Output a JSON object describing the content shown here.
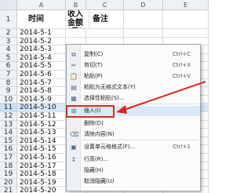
{
  "sheet": {
    "columns": [
      "A",
      "B",
      "C",
      "D",
      "E"
    ],
    "header": {
      "rownum": "1",
      "a": "时间",
      "b": "收入金额(元)",
      "c": "备注"
    },
    "rows": [
      {
        "num": "2",
        "date": "2014-5-1"
      },
      {
        "num": "3",
        "date": "2014-5-2"
      },
      {
        "num": "4",
        "date": "2014-5-3"
      },
      {
        "num": "5",
        "date": "2014-5-4"
      },
      {
        "num": "6",
        "date": "2014-5-5"
      },
      {
        "num": "7",
        "date": "2014-5-6"
      },
      {
        "num": "8",
        "date": "2014-5-7"
      },
      {
        "num": "9",
        "date": "2014-5-8"
      },
      {
        "num": "10",
        "date": "2014-5-9"
      },
      {
        "num": "11",
        "date": "2014-5-10"
      },
      {
        "num": "12",
        "date": "2014-5-11"
      },
      {
        "num": "13",
        "date": "2014-5-12"
      },
      {
        "num": "14",
        "date": "2014-5-13"
      },
      {
        "num": "15",
        "date": "2014-5-14"
      },
      {
        "num": "16",
        "date": "2014-5-15"
      },
      {
        "num": "17",
        "date": "2014-5-16"
      },
      {
        "num": "18",
        "date": "2014-5-17"
      },
      {
        "num": "19",
        "date": "2014-5-18"
      },
      {
        "num": "20",
        "date": "2014-5-19"
      },
      {
        "num": "21",
        "date": "2014-5-20"
      }
    ]
  },
  "menu": {
    "items": [
      {
        "icon": "copy-icon",
        "glyph": "⧉",
        "label": "复制(C)",
        "shortcut": "Ctrl+C"
      },
      {
        "icon": "cut-icon",
        "glyph": "✂",
        "label": "剪切(T)",
        "shortcut": "Ctrl+X"
      },
      {
        "icon": "paste-icon",
        "glyph": "📋",
        "label": "粘贴(P)",
        "shortcut": "Ctrl+V"
      },
      {
        "icon": "paste-text-icon",
        "glyph": "▤",
        "label": "粘贴为无格式文本(Y)",
        "shortcut": ""
      },
      {
        "icon": "paste-special-icon",
        "glyph": "▦",
        "label": "选择性粘贴(S)...",
        "shortcut": ""
      },
      {
        "icon": "insert-icon",
        "glyph": "⊞",
        "label": "插入(I)",
        "shortcut": ""
      },
      {
        "icon": "delete-icon",
        "glyph": "",
        "label": "删除(D)",
        "shortcut": ""
      },
      {
        "icon": "clear-icon",
        "glyph": "⌫",
        "label": "清除内容(N)",
        "shortcut": ""
      },
      {
        "icon": "format-cells-icon",
        "glyph": "▣",
        "label": "设置单元格格式(F)...",
        "shortcut": "Ctrl+1"
      },
      {
        "icon": "row-height-icon",
        "glyph": "↕",
        "label": "行高(R)...",
        "shortcut": ""
      },
      {
        "icon": "hide-icon",
        "glyph": "",
        "label": "隐藏(H)",
        "shortcut": ""
      },
      {
        "icon": "unhide-icon",
        "glyph": "",
        "label": "取消隐藏(U)",
        "shortcut": ""
      }
    ],
    "highlighted_item": "插入(I)"
  },
  "colors": {
    "highlight_border": "#d9291c",
    "arrow": "#d9291c",
    "selection": "#d7e8fa"
  }
}
